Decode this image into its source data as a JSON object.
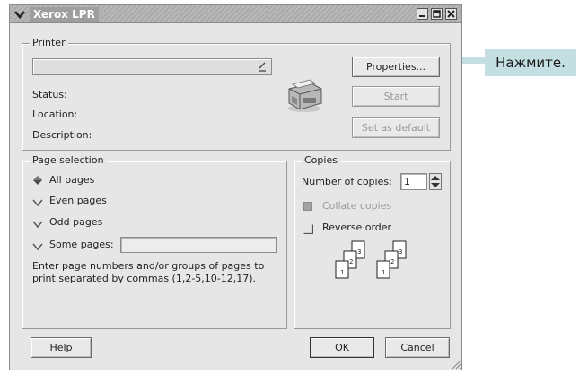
{
  "window": {
    "title": "Xerox LPR",
    "menu_icon": "chevron-down-icon",
    "controls": [
      "minimize-icon",
      "maximize-icon",
      "close-icon"
    ]
  },
  "printer": {
    "legend": "Printer",
    "selected_printer": "",
    "status_label": "Status:",
    "location_label": "Location:",
    "description_label": "Description:",
    "printer_icon": "printer-icon",
    "properties_button": "Properties...",
    "start_button": "Start",
    "set_default_button": "Set as default"
  },
  "page_selection": {
    "legend": "Page selection",
    "options": [
      "All pages",
      "Even pages",
      "Odd pages",
      "Some pages:"
    ],
    "selected": "All pages",
    "some_pages_value": "",
    "hint": "Enter page numbers and/or groups of pages to print separated by commas (1,2-5,10-12,17)."
  },
  "copies": {
    "legend": "Copies",
    "number_label": "Number of copies:",
    "number_value": "1",
    "collate_label": "Collate copies",
    "collate_checked": true,
    "collate_enabled": false,
    "reverse_label": "Reverse order",
    "reverse_checked": false,
    "collate_illustration": "collate-pages-icon",
    "page_numbers": [
      "1",
      "2",
      "3"
    ]
  },
  "footer": {
    "help_button": "Help",
    "ok_button": "OK",
    "cancel_button": "Cancel"
  },
  "callout": {
    "text": "Нажмите.",
    "color": "#c4dfe2"
  }
}
